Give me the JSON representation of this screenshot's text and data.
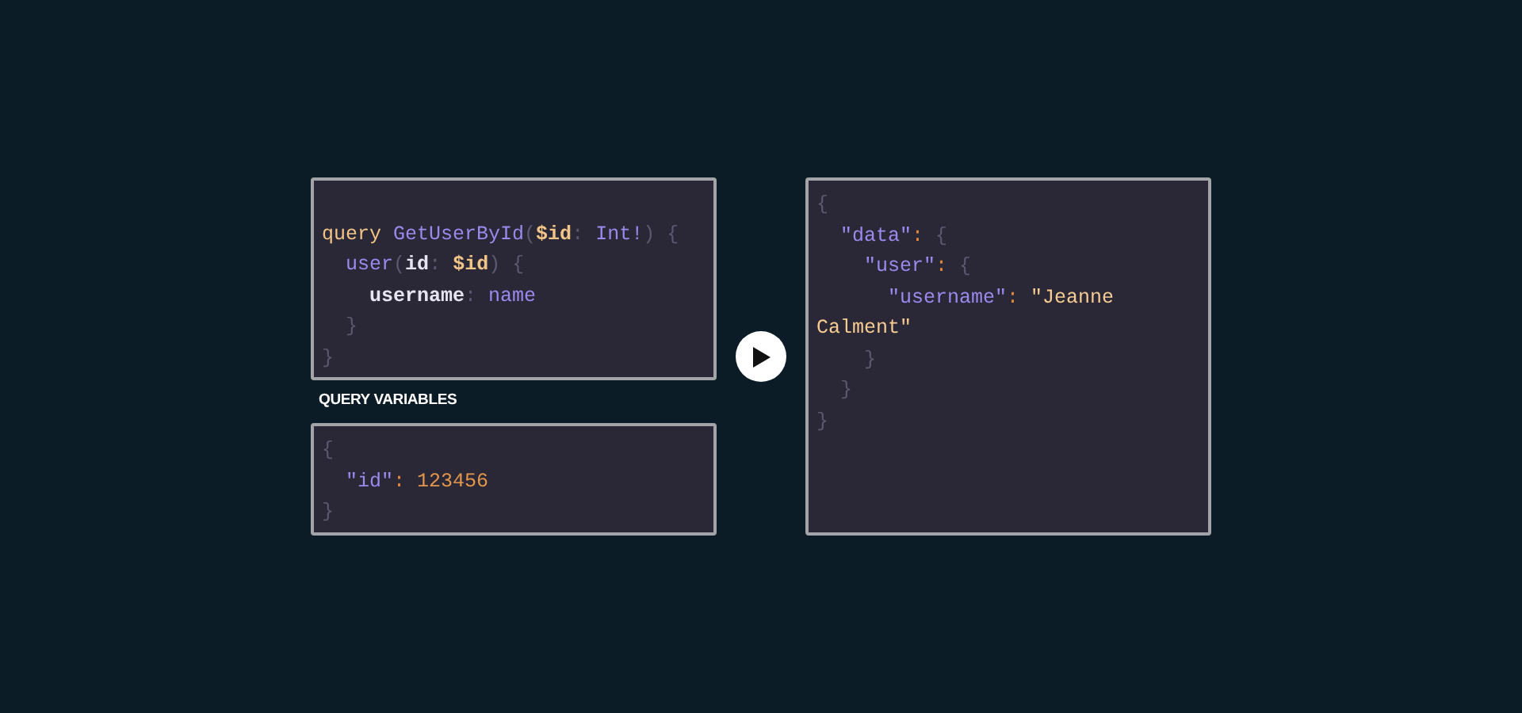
{
  "query_editor": {
    "lines": [
      {
        "tokens": [
          {
            "kind": "keyword",
            "text": "query "
          },
          {
            "kind": "name",
            "text": "GetUserById"
          },
          {
            "kind": "punct",
            "text": "("
          },
          {
            "kind": "variable",
            "text": "$id"
          },
          {
            "kind": "punct",
            "text": ": "
          },
          {
            "kind": "name",
            "text": "Int!"
          },
          {
            "kind": "punct",
            "text": ") {"
          }
        ],
        "children": [
          {
            "tokens": [
              {
                "kind": "name",
                "text": "user"
              },
              {
                "kind": "punct",
                "text": "("
              },
              {
                "kind": "field",
                "text": "id"
              },
              {
                "kind": "punct",
                "text": ": "
              },
              {
                "kind": "variable",
                "text": "$id"
              },
              {
                "kind": "punct",
                "text": ") {"
              }
            ],
            "children": [
              {
                "tokens": [
                  {
                    "kind": "field",
                    "text": "username"
                  },
                  {
                    "kind": "punct",
                    "text": ": "
                  },
                  {
                    "kind": "name",
                    "text": "name"
                  }
                ]
              }
            ]
          },
          {
            "tokens": [
              {
                "kind": "punct",
                "text": "}"
              }
            ]
          }
        ]
      },
      {
        "tokens": [
          {
            "kind": "punct",
            "text": "}"
          }
        ]
      }
    ]
  },
  "variables_label": "QUERY VARIABLES",
  "variables_editor": {
    "lines": [
      {
        "tokens": [
          {
            "kind": "punct",
            "text": "{"
          }
        ],
        "children": [
          {
            "tokens": [
              {
                "kind": "key",
                "text": "\"id\""
              },
              {
                "kind": "colon",
                "text": ": "
              },
              {
                "kind": "number",
                "text": "123456"
              }
            ]
          }
        ]
      },
      {
        "tokens": [
          {
            "kind": "punct",
            "text": "}"
          }
        ]
      }
    ]
  },
  "result_viewer": {
    "lines": [
      {
        "tokens": [
          {
            "kind": "punct",
            "text": "{"
          }
        ],
        "children": [
          {
            "tokens": [
              {
                "kind": "key",
                "text": "\"data\""
              },
              {
                "kind": "colon",
                "text": ": "
              },
              {
                "kind": "punct",
                "text": "{"
              }
            ],
            "children": [
              {
                "tokens": [
                  {
                    "kind": "key",
                    "text": "\"user\""
                  },
                  {
                    "kind": "colon",
                    "text": ": "
                  },
                  {
                    "kind": "punct",
                    "text": "{"
                  }
                ],
                "children": [
                  {
                    "tokens": [
                      {
                        "kind": "key",
                        "text": "\"username\""
                      },
                      {
                        "kind": "colon",
                        "text": ": "
                      },
                      {
                        "kind": "string",
                        "text": "\"Jeanne Calment\""
                      }
                    ]
                  }
                ]
              },
              {
                "tokens": [
                  {
                    "kind": "punct",
                    "text": "}"
                  }
                ]
              }
            ]
          },
          {
            "tokens": [
              {
                "kind": "punct",
                "text": "}"
              }
            ]
          }
        ]
      },
      {
        "tokens": [
          {
            "kind": "punct",
            "text": "}"
          }
        ]
      }
    ]
  }
}
